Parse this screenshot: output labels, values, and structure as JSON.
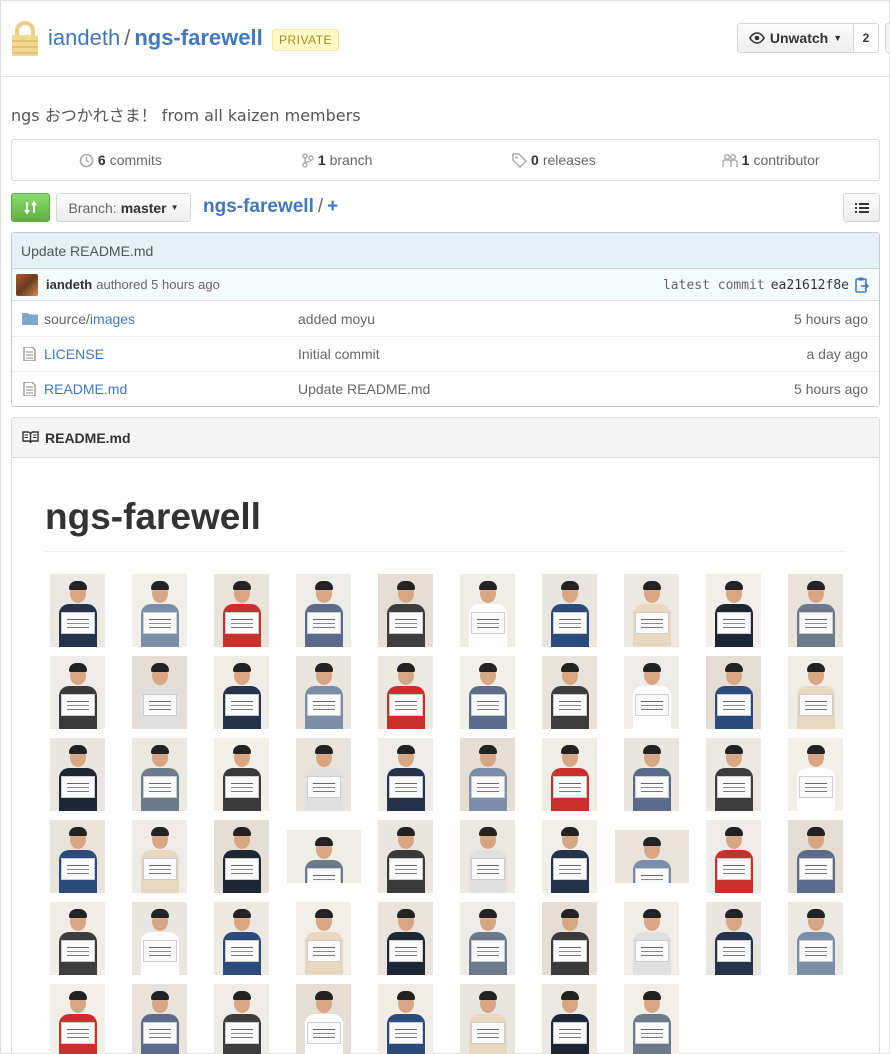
{
  "repo": {
    "owner": "iandeth",
    "separator": "/",
    "name": "ngs-farewell",
    "visibility": "PRIVATE",
    "description": "ngs おつかれさま！ from all kaizen members"
  },
  "watch": {
    "label": "Unwatch",
    "count": "2"
  },
  "stats": {
    "commits_count": "6",
    "commits_label": "commits",
    "branches_count": "1",
    "branches_label": "branch",
    "releases_count": "0",
    "releases_label": "releases",
    "contributors_count": "1",
    "contributors_label": "contributor"
  },
  "toolbar": {
    "branch_prefix": "Branch:",
    "branch_name": "master",
    "breadcrumb_root": "ngs-farewell",
    "breadcrumb_sep": "/",
    "breadcrumb_add": "+"
  },
  "commit": {
    "message": "Update README.md",
    "author": "iandeth",
    "authored_text": "authored 5 hours ago",
    "latest_label": "latest commit",
    "sha": "ea21612f8e"
  },
  "files": [
    {
      "type": "dir",
      "prefix": "source/",
      "name": "images",
      "message": "added moyu",
      "age": "5 hours ago"
    },
    {
      "type": "file",
      "prefix": "",
      "name": "LICENSE",
      "message": "Initial commit",
      "age": "a day ago"
    },
    {
      "type": "file",
      "prefix": "",
      "name": "README.md",
      "message": "Update README.md",
      "age": "5 hours ago"
    }
  ],
  "readme": {
    "header": "README.md",
    "title": "ngs-farewell"
  },
  "photo_count": 58,
  "colors": {
    "link": "#4078c0",
    "green": "#60b044",
    "private_bg": "#fff9c4",
    "commit_bg": "#e6f1f6"
  }
}
